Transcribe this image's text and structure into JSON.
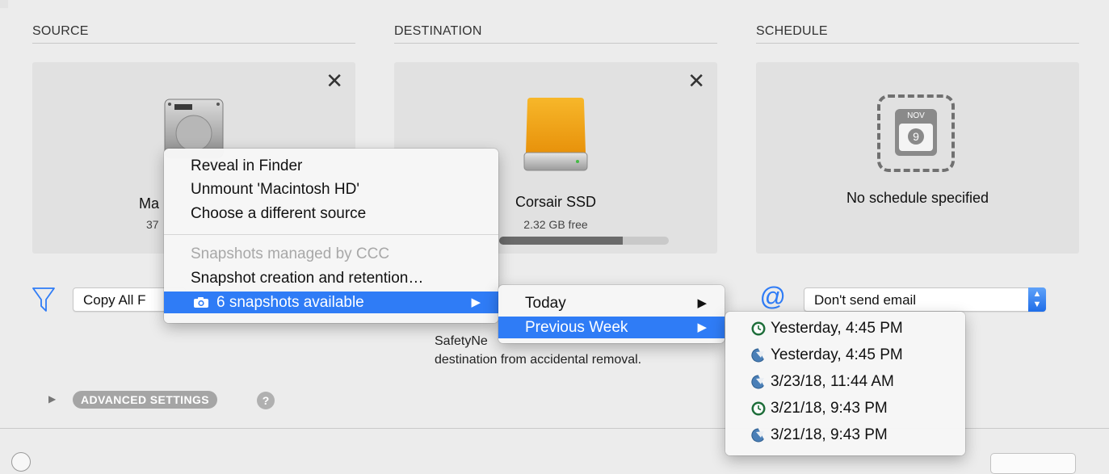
{
  "sections": {
    "source": "SOURCE",
    "destination": "DESTINATION",
    "schedule": "SCHEDULE"
  },
  "source": {
    "name_partial": "Ma",
    "size_partial": "37"
  },
  "destination": {
    "name": "Corsair SSD",
    "free": "2.32 GB free",
    "used_fraction": 0.73
  },
  "schedule": {
    "month": "NOV",
    "day": "9",
    "status": "No schedule specified"
  },
  "filter": {
    "value": "Copy All F"
  },
  "email": {
    "at": "@",
    "value": "Don't send email"
  },
  "safetynet": {
    "line1": "SafetyNe",
    "line2": "destination from accidental removal."
  },
  "advanced": {
    "label": "ADVANCED SETTINGS",
    "help": "?"
  },
  "context_menu": {
    "items": [
      "Reveal in Finder",
      "Unmount 'Macintosh HD'",
      "Choose a different source",
      "Snapshots managed by CCC",
      "Snapshot creation and retention…",
      "6 snapshots available"
    ]
  },
  "submenu": {
    "items": [
      "Today",
      "Previous Week"
    ]
  },
  "snapshots": {
    "items": [
      {
        "label": "Yesterday, 4:45 PM",
        "icon": "time-machine-icon"
      },
      {
        "label": "Yesterday, 4:45 PM",
        "icon": "ccc-icon"
      },
      {
        "label": "3/23/18, 11:44 AM",
        "icon": "ccc-icon"
      },
      {
        "label": "3/21/18, 9:43 PM",
        "icon": "time-machine-icon"
      },
      {
        "label": "3/21/18, 9:43 PM",
        "icon": "ccc-icon"
      }
    ]
  },
  "colors": {
    "accent": "#2f7cf6",
    "ssd_orange": "#f3a51a"
  }
}
